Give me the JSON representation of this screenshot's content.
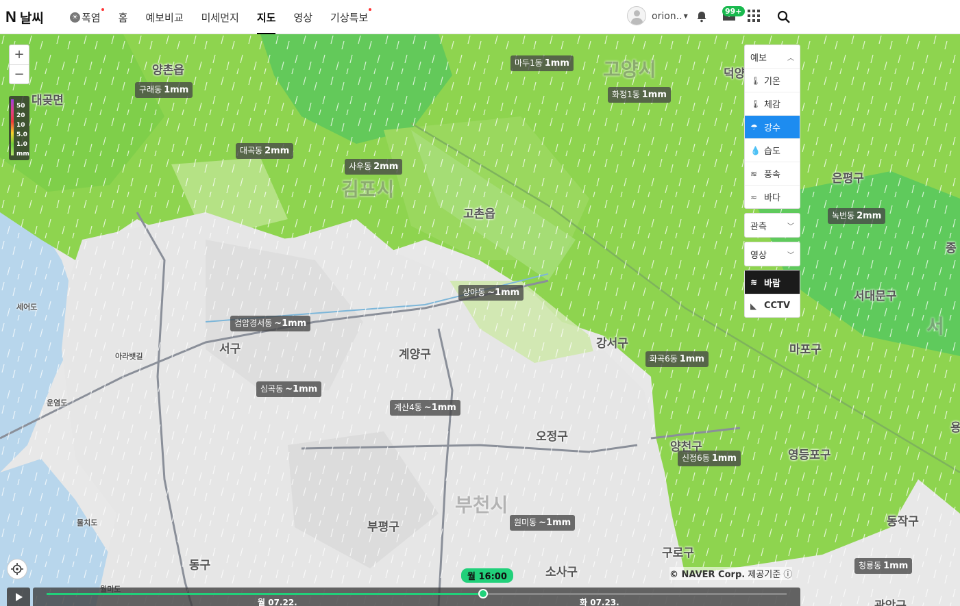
{
  "header": {
    "logo_n": "N",
    "logo_text": "날씨",
    "nav": [
      {
        "label": "폭염",
        "hot": true,
        "dot": true
      },
      {
        "label": "홈"
      },
      {
        "label": "예보비교"
      },
      {
        "label": "미세먼지"
      },
      {
        "label": "지도",
        "active": true
      },
      {
        "label": "영상"
      },
      {
        "label": "기상특보",
        "dot": true
      }
    ],
    "user_name": "orion..",
    "mail_badge": "99+"
  },
  "map": {
    "zoom_in": "+",
    "zoom_out": "−",
    "legend_unit": "mm",
    "legend_values": [
      "50",
      "20",
      "10",
      "5.0",
      "1.0"
    ],
    "places": {
      "yangchon": "양촌읍",
      "daegot": "대곶면",
      "gimpo": "김포시",
      "goyang": "고양시",
      "deogyang": "덕양",
      "gochon": "고촌읍",
      "eunpyeong": "은평구",
      "seodaemun": "서대문구",
      "mapo": "마포구",
      "jongno": "종",
      "gangseo": "강서구",
      "seogu": "서구",
      "gyeyang": "계양구",
      "ojeong": "오정구",
      "yangcheon": "양천구",
      "yeongdeungpo": "영등포구",
      "bucheon": "부천시",
      "bupyeong": "부평구",
      "guro": "구로구",
      "dongjak": "동작구",
      "sosa": "소사구",
      "donggu": "동구",
      "gwanak": "관악구",
      "seoul": "서",
      "yong": "용",
      "seoyeo": "세어도",
      "arabaet": "아라뱃길",
      "unyeom": "운염도",
      "mulchi": "물치도",
      "wolmi": "월미도"
    },
    "chips": [
      {
        "name": "마두1동",
        "val": "1mm"
      },
      {
        "name": "구래동",
        "val": "1mm"
      },
      {
        "name": "화정1동",
        "val": "1mm"
      },
      {
        "name": "대곡동",
        "val": "2mm"
      },
      {
        "name": "사우동",
        "val": "2mm"
      },
      {
        "name": "녹번동",
        "val": "2mm"
      },
      {
        "name": "상야동",
        "val": "~1mm"
      },
      {
        "name": "검암경서동",
        "val": "~1mm"
      },
      {
        "name": "화곡6동",
        "val": "1mm"
      },
      {
        "name": "심곡동",
        "val": "~1mm"
      },
      {
        "name": "계산4동",
        "val": "~1mm"
      },
      {
        "name": "신정6동",
        "val": "1mm"
      },
      {
        "name": "원미동",
        "val": "~1mm"
      },
      {
        "name": "청룡동",
        "val": "1mm"
      }
    ],
    "panel": {
      "forecast": "예보",
      "items": [
        {
          "label": "기온",
          "icon": "thermometer-icon"
        },
        {
          "label": "체감",
          "icon": "feels-like-icon"
        },
        {
          "label": "강수",
          "icon": "umbrella-icon"
        },
        {
          "label": "습도",
          "icon": "droplet-icon"
        },
        {
          "label": "풍속",
          "icon": "wind-speed-icon"
        },
        {
          "label": "바다",
          "icon": "wave-icon"
        }
      ],
      "selected": "강수",
      "observe": "관측",
      "video": "영상",
      "wind": "바람",
      "cctv": "CCTV"
    },
    "copyright": "© NAVER Corp.",
    "provider": "제공기준",
    "time_tip": "월 16:00",
    "progress": 0.59,
    "dates": [
      "월 07.22.",
      "화 07.23."
    ]
  },
  "colors": {
    "accent": "#1d8cf0",
    "timebar": "#21d07a",
    "badge": "#19b94e"
  }
}
